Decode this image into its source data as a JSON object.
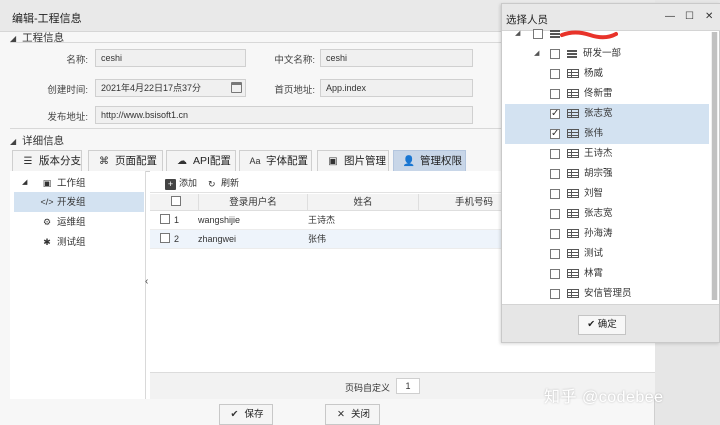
{
  "window": {
    "title": "编辑-工程信息"
  },
  "project_section": {
    "title": "工程信息",
    "fields": {
      "name_label": "名称:",
      "name_value": "ceshi",
      "cn_name_label": "中文名称:",
      "cn_name_value": "ceshi",
      "created_label": "创建时间:",
      "created_value": "2021年4月22日17点37分",
      "home_label": "首页地址:",
      "home_value": "App.index",
      "publish_label": "发布地址:",
      "publish_value": "http://www.bsisoft1.cn"
    }
  },
  "detail_section": {
    "title": "详细信息"
  },
  "tabs": [
    {
      "label": "版本分支",
      "icon": "list-icon",
      "active": false
    },
    {
      "label": "页面配置",
      "icon": "command-icon",
      "active": false
    },
    {
      "label": "API配置",
      "icon": "cloud-icon",
      "active": false
    },
    {
      "label": "字体配置",
      "icon": "font-icon",
      "active": false
    },
    {
      "label": "图片管理",
      "icon": "image-icon",
      "active": false
    },
    {
      "label": "管理权限",
      "icon": "user-lock-icon",
      "active": true
    }
  ],
  "tree": [
    {
      "label": "工作组",
      "icon": "user-card-icon"
    },
    {
      "label": "开发组",
      "icon": "code-icon"
    },
    {
      "label": "运维组",
      "icon": "gears-icon"
    },
    {
      "label": "测试组",
      "icon": "bug-icon"
    }
  ],
  "toolbar": {
    "add_label": "添加",
    "refresh_label": "刷新"
  },
  "grid": {
    "columns": [
      "登录用户名",
      "姓名",
      "手机号码"
    ],
    "rows": [
      {
        "num": "1",
        "username": "wangshijie",
        "name": "王诗杰"
      },
      {
        "num": "2",
        "username": "zhangwei",
        "name": "张伟"
      }
    ]
  },
  "pager": {
    "label": "页码自定义",
    "value": "1"
  },
  "buttons": {
    "save": "保存",
    "close": "关闭"
  },
  "picker": {
    "title": "选择人员",
    "dept": "研发一部",
    "people": [
      {
        "name": "杨威",
        "checked": false
      },
      {
        "name": "佟新雷",
        "checked": false
      },
      {
        "name": "张志宽",
        "checked": true
      },
      {
        "name": "张伟",
        "checked": true
      },
      {
        "name": "王诗杰",
        "checked": false
      },
      {
        "name": "胡宗强",
        "checked": false
      },
      {
        "name": "刘智",
        "checked": false
      },
      {
        "name": "张志宽",
        "checked": false
      },
      {
        "name": "孙海涛",
        "checked": false
      },
      {
        "name": "测试",
        "checked": false
      },
      {
        "name": "林霄",
        "checked": false
      },
      {
        "name": "安信管理员",
        "checked": false
      }
    ],
    "ok_label": "确定"
  },
  "watermark": "知乎 @codebee",
  "colors": {
    "active_tab": "#c8d6e8",
    "selection": "#d3e2f1",
    "redaction": "#e8332a"
  }
}
